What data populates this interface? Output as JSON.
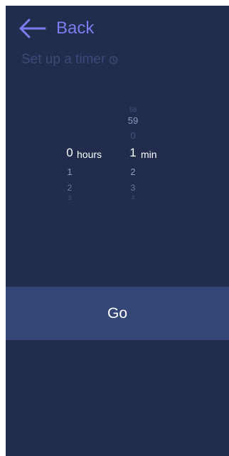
{
  "header": {
    "back_label": "Back",
    "back_icon": "arrow-left-icon",
    "subtitle": "Set up a timer",
    "subtitle_icon": "timer-icon"
  },
  "picker": {
    "hours": {
      "selected": "0",
      "unit": "hours",
      "below": [
        "1",
        "2",
        "3"
      ]
    },
    "minutes": {
      "above": [
        "58",
        "59",
        "0"
      ],
      "selected": "1",
      "unit": "min",
      "below": [
        "2",
        "3",
        "4"
      ]
    }
  },
  "go_button": {
    "label": "Go"
  },
  "colors": {
    "background": "#222d4e",
    "accent": "#7b7ef0",
    "button_bar": "#344675",
    "subtitle": "#3a4a78"
  }
}
